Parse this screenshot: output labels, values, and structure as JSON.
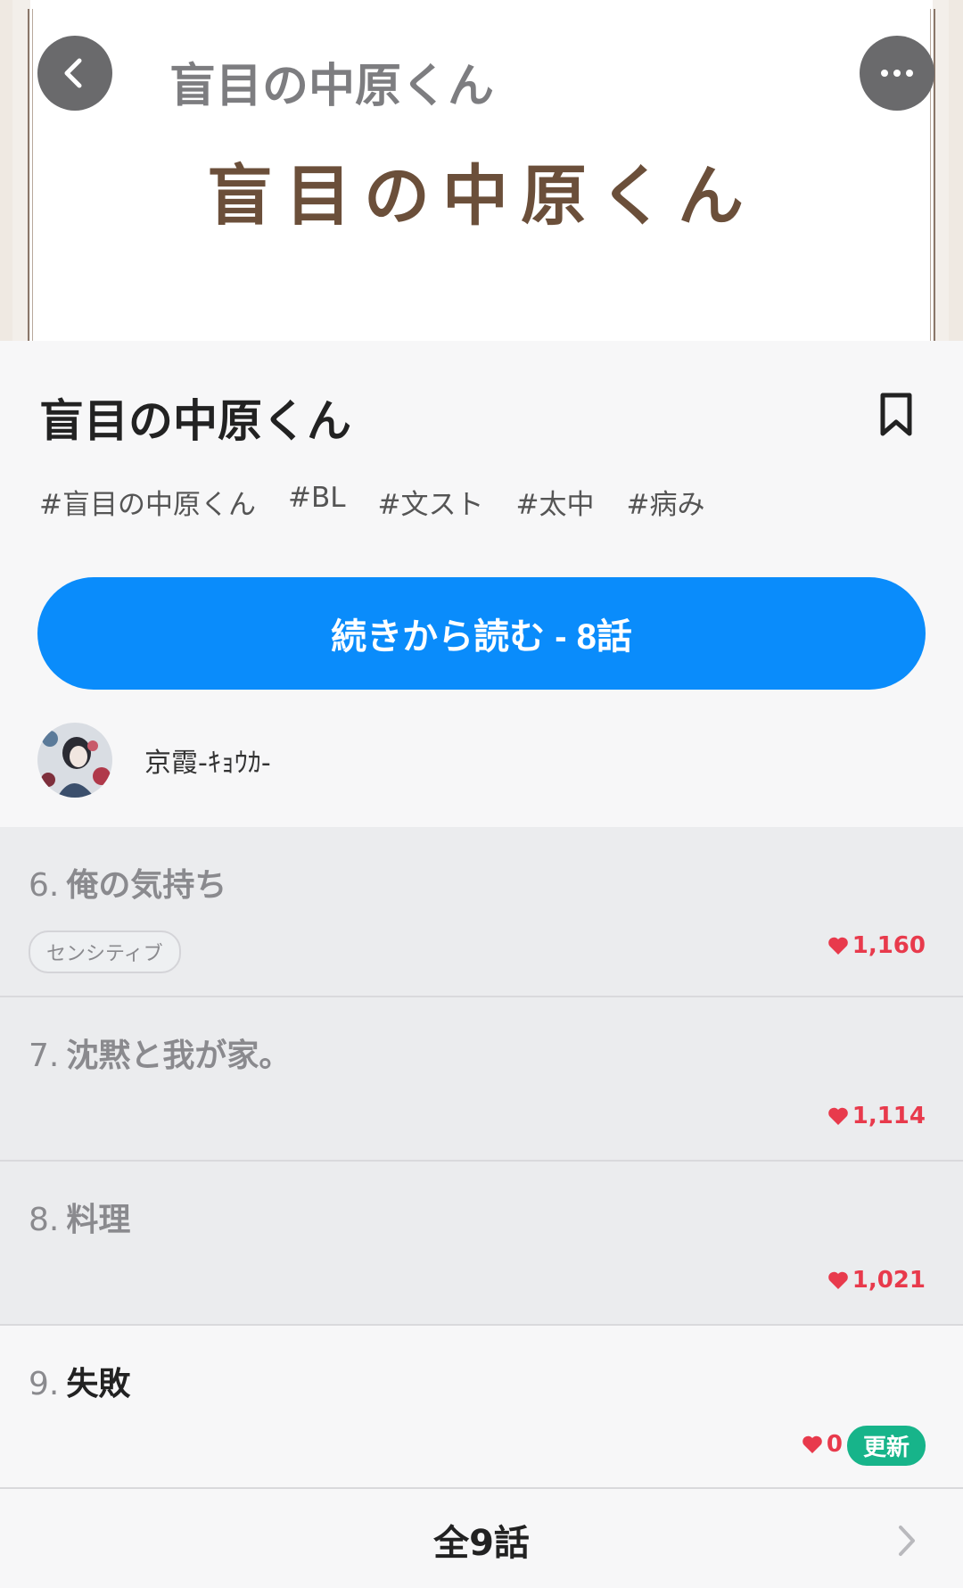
{
  "header": {
    "title": "盲目の中原くん",
    "cover_text": "盲目の中原くん",
    "back_icon": "chevron-left-icon",
    "more_icon": "more-horizontal-icon"
  },
  "work": {
    "title": "盲目の中原くん",
    "bookmark_icon": "bookmark-icon",
    "tags": [
      "#盲目の中原くん",
      "#BL",
      "#文スト",
      "#太中",
      "#病み"
    ],
    "continue_label": "続きから読む - 8話",
    "author": "京霞-ｷｮｳｶ-"
  },
  "episodes": [
    {
      "num": "6.",
      "title": "俺の気持ち",
      "tag": "センシティブ",
      "likes": "1,160",
      "state": "read"
    },
    {
      "num": "7.",
      "title": "沈黙と我が家。",
      "likes": "1,114",
      "state": "read"
    },
    {
      "num": "8.",
      "title": "料理",
      "likes": "1,021",
      "state": "read"
    },
    {
      "num": "9.",
      "title": "失敗",
      "likes": "0",
      "badge": "更新",
      "state": "unread"
    }
  ],
  "footer": {
    "label": "全9話"
  },
  "colors": {
    "accent": "#0a8cfb",
    "like": "#e83a4c",
    "badge": "#17b48a"
  }
}
